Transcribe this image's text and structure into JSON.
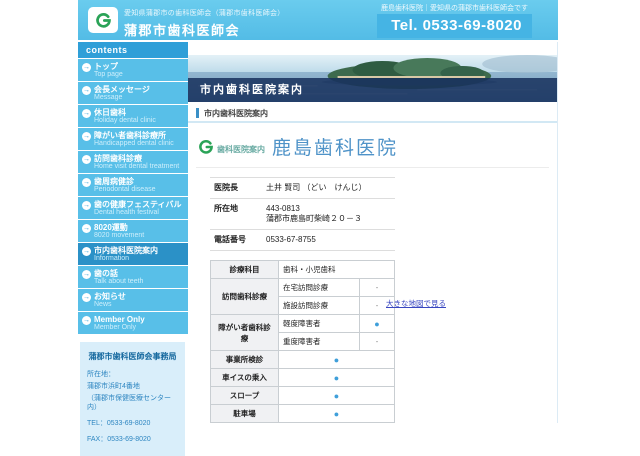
{
  "header": {
    "tagline": "愛知県蒲郡市の歯科医師会（蒲郡市歯科医師会）",
    "site_name": "蒲郡市歯科医師会",
    "tel_tagline": "鹿島歯科医院｜愛知県の蒲郡市歯科医師会です",
    "tel": "Tel. 0533-69-8020"
  },
  "sidebar": {
    "contents_label": "contents",
    "items": [
      {
        "label": "トップ",
        "sub": "Top page"
      },
      {
        "label": "会長メッセージ",
        "sub": "Message"
      },
      {
        "label": "休日歯科",
        "sub": "Holiday dental clinic"
      },
      {
        "label": "障がい者歯科診療所",
        "sub": "Handicapped dental clinic"
      },
      {
        "label": "訪問歯科診療",
        "sub": "Home visit dental treatment"
      },
      {
        "label": "歯周病健診",
        "sub": "Periodontal disease"
      },
      {
        "label": "歯の健康フェスティバル",
        "sub": "Dental health festival"
      },
      {
        "label": "8020運動",
        "sub": "8020 movement"
      },
      {
        "label": "市内歯科医院案内",
        "sub": "Information"
      },
      {
        "label": "歯の話",
        "sub": "Talk about teeth"
      },
      {
        "label": "お知らせ",
        "sub": "News"
      },
      {
        "label": "Member Only",
        "sub": "Member Only"
      }
    ],
    "office": {
      "title": "蒲郡市歯科医師会事務局",
      "line1": "所在地：",
      "line2": "蒲郡市浜町4番地",
      "line3": "（蒲郡市保健医療センター内）",
      "line4": "TEL：0533-69-8020",
      "line5": "FAX：0533-69-8020"
    }
  },
  "hero": {
    "title": "市内歯科医院案内"
  },
  "breadcrumb": {
    "label": "市内歯科医院案内"
  },
  "clinic": {
    "section_label": "歯科医院案内",
    "name": "鹿島歯科医院",
    "director_label": "医院長",
    "director": "土井 賢司 （どい　けんじ）",
    "address_label": "所在地",
    "zip": "443-0813",
    "address": "蒲郡市鹿島町柴崎２０－３",
    "tel_label": "電話番号",
    "tel": "0533-67-8755"
  },
  "services": {
    "dept_label": "診療科目",
    "dept_value": "歯科・小児歯科",
    "visit_label": "訪問歯科診療",
    "visit_home": "在宅訪問診療",
    "visit_home_mark": "-",
    "visit_facility": "施設訪問診療",
    "visit_facility_mark": "-",
    "disabled_label": "障がい者歯科診療",
    "disabled_mild": "軽度障害者",
    "disabled_mild_mark": "●",
    "disabled_severe": "重度障害者",
    "disabled_severe_mark": "-",
    "checkup_label": "事業所検診",
    "checkup_mark": "●",
    "wheelchair_label": "車イスの乗入",
    "wheelchair_mark": "●",
    "slope_label": "スロープ",
    "slope_mark": "●",
    "parking_label": "駐車場",
    "parking_mark": "●"
  },
  "map": {
    "link": "大きな地図で見る"
  },
  "colors": {
    "header_blue": "#58bfe8",
    "accent_blue": "#2f9fd8",
    "active_blue": "#2b91c7",
    "dot_blue": "#3f9fda",
    "logo_green": "#2aa357"
  }
}
